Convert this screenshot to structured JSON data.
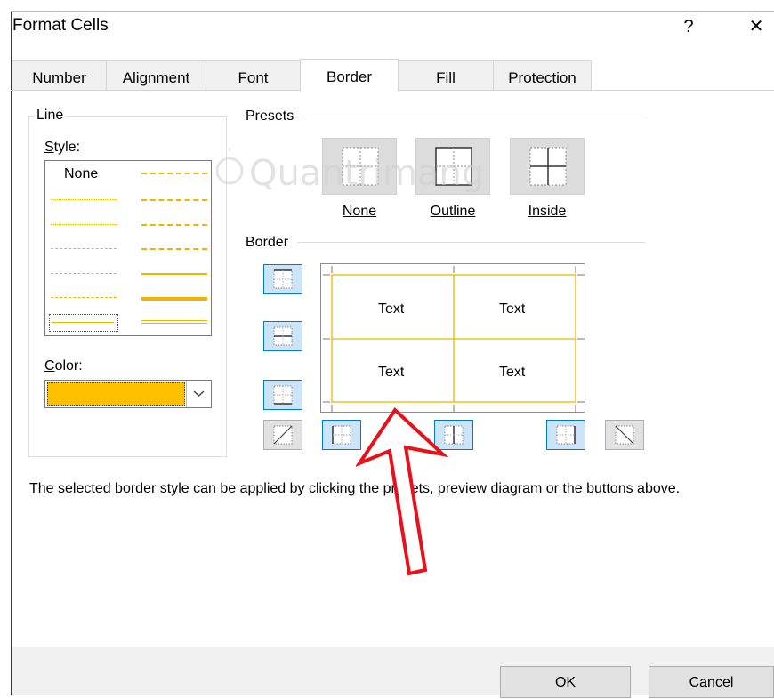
{
  "window": {
    "title": "Format Cells",
    "help_glyph": "?",
    "close_glyph": "✕"
  },
  "tabs": [
    {
      "label": "Number"
    },
    {
      "label": "Alignment"
    },
    {
      "label": "Font"
    },
    {
      "label": "Border",
      "active": true
    },
    {
      "label": "Fill"
    },
    {
      "label": "Protection"
    }
  ],
  "line": {
    "group_label": "Line",
    "style_label": "Style:",
    "style_none": "None",
    "color_label": "Color:",
    "color_value": "#ffc000"
  },
  "presets": {
    "group_label": "Presets",
    "items": [
      {
        "label": "None"
      },
      {
        "label": "Outline"
      },
      {
        "label": "Inside"
      }
    ]
  },
  "border": {
    "group_label": "Border",
    "preview_texts": [
      "Text",
      "Text",
      "Text",
      "Text"
    ],
    "line_color": "#f0b400"
  },
  "hint": "The selected border style can be applied by clicking the presets, preview diagram or the buttons above.",
  "buttons": {
    "ok": "OK",
    "cancel": "Cancel"
  },
  "watermark": "Quantrimang",
  "annotation": {
    "arrow_color": "#e8101b"
  }
}
